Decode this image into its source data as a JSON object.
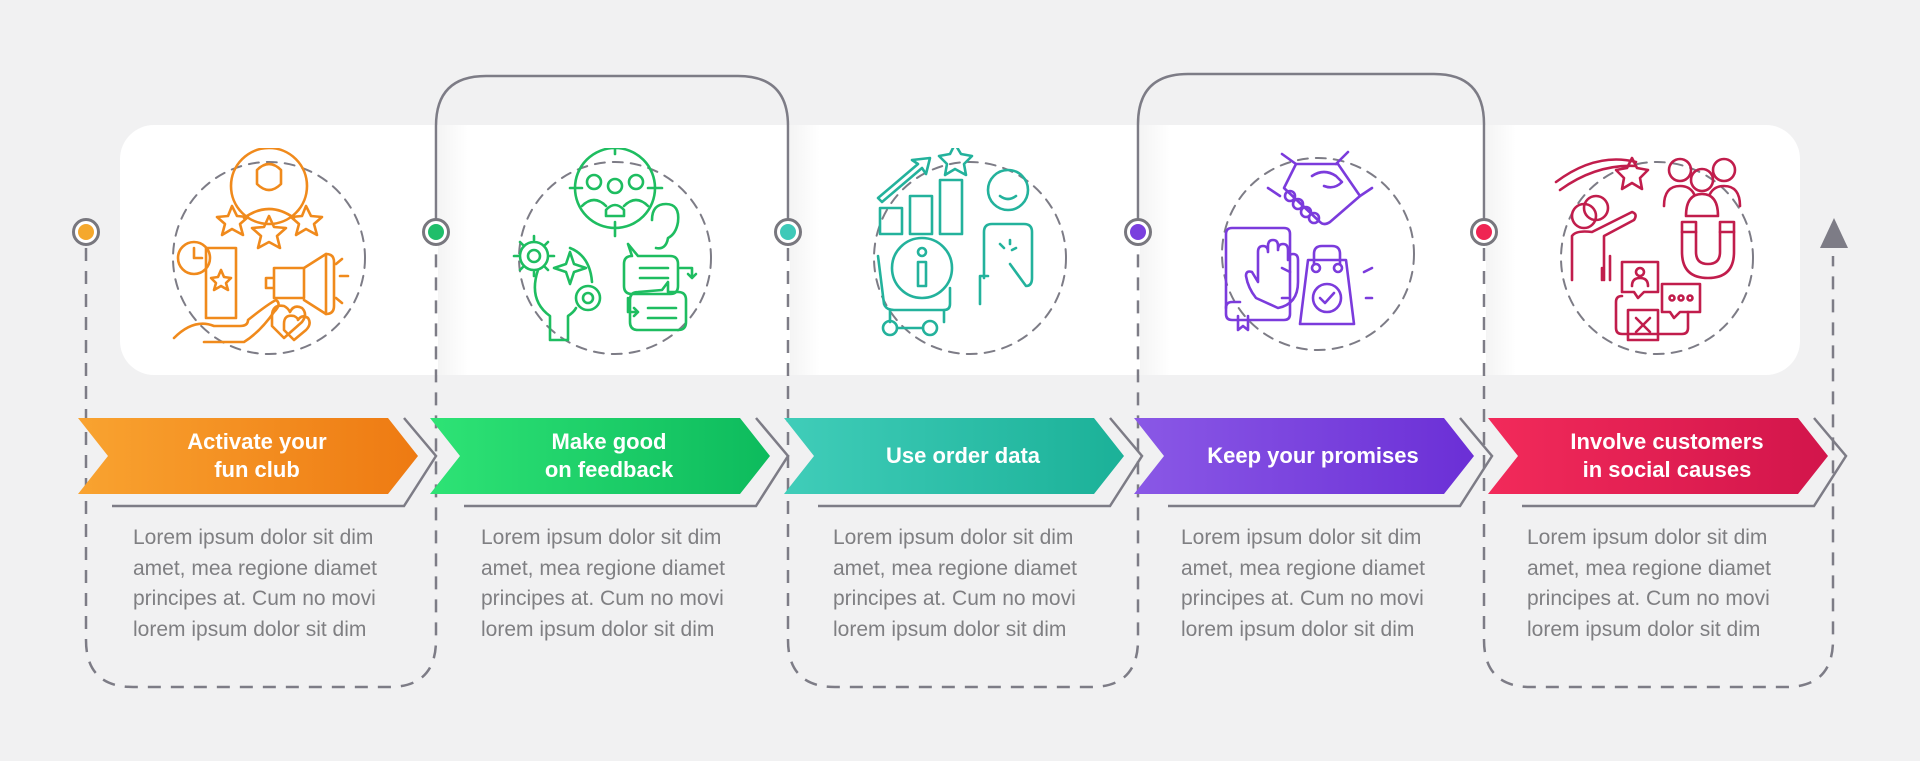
{
  "steps": [
    {
      "title": "Activate your fun club",
      "title_lines": [
        "Activate your",
        "fun club"
      ],
      "icon": "fan-club-icon",
      "color": "#f28a1d",
      "gradient": [
        "#f9a330",
        "#ee7a12"
      ],
      "description": "Lorem ipsum dolor sit dim amet, mea regione diamet principes at. Cum no movi lorem ipsum dolor sit dim"
    },
    {
      "title": "Make good on feedback",
      "title_lines": [
        "Make good",
        "on feedback"
      ],
      "icon": "feedback-icon",
      "color": "#22c064",
      "gradient": [
        "#2ee375",
        "#0dbb5d"
      ],
      "description": "Lorem ipsum dolor sit dim amet, mea regione diamet principes at. Cum no movi lorem ipsum dolor sit dim"
    },
    {
      "title": "Use order data",
      "title_lines": [
        "Use order data"
      ],
      "icon": "order-data-icon",
      "color": "#2ab39f",
      "gradient": [
        "#40cdb9",
        "#1bb198"
      ],
      "description": "Lorem ipsum dolor sit dim amet, mea regione diamet principes at. Cum no movi lorem ipsum dolor sit dim"
    },
    {
      "title": "Keep your promises",
      "title_lines": [
        "Keep your promises"
      ],
      "icon": "promises-icon",
      "color": "#7d3fdc",
      "gradient": [
        "#8a58e6",
        "#6b2fd6"
      ],
      "description": "Lorem ipsum dolor sit dim amet, mea regione diamet principes at. Cum no movi lorem ipsum dolor sit dim"
    },
    {
      "title": "Involve customers in social causes",
      "title_lines": [
        "Involve customers",
        "in social causes"
      ],
      "icon": "social-causes-icon",
      "color": "#c51d4d",
      "gradient": [
        "#f22a5a",
        "#d2154b"
      ],
      "description": "Lorem ipsum dolor sit dim amet, mea regione diamet principes at. Cum no movi lorem ipsum dolor sit dim"
    }
  ],
  "dot_colors": [
    "#f5a82c",
    "#1fbe6a",
    "#3ec9b8",
    "#7a3fde",
    "#ef2452"
  ],
  "line_color": "#7d7c86"
}
